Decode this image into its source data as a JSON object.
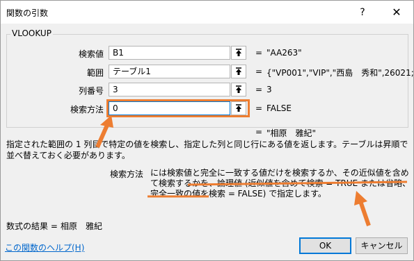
{
  "window": {
    "title": "関数の引数",
    "help_glyph": "?",
    "close_glyph": "✕"
  },
  "function_name": "VLOOKUP",
  "args": [
    {
      "label": "検索値",
      "value": "B1",
      "equals": "=",
      "result": "\"AA263\""
    },
    {
      "label": "範囲",
      "value": "テーブル1",
      "equals": "=",
      "result": "{\"VP001\",\"VIP\",\"西島　秀和\",26021;\""
    },
    {
      "label": "列番号",
      "value": "3",
      "equals": "=",
      "result": "3"
    },
    {
      "label": "検索方法",
      "value": "0",
      "equals": "=",
      "result": "FALSE"
    }
  ],
  "overall_result": {
    "equals": "=",
    "value": "\"相原　雅紀\""
  },
  "description": "指定された範囲の 1 列目で特定の値を検索し、指定した列と同じ行にある値を返します。テーブルは昇順で並べ替えておく必要があります。",
  "arg_help": {
    "name": "検索方法",
    "text": "には検索値と完全に一致する値だけを検索するか、その近似値を含めて検索するかを、論理値 (近似値を含めて検索 = TRUE または省略、完全一致の値を検索 = FALSE) で指定します。"
  },
  "formula_result": {
    "label": "数式の結果 =",
    "value": "相原　雅紀"
  },
  "help_link": "この関数のヘルプ(H)",
  "buttons": {
    "ok": "OK",
    "cancel": "キャンセル"
  },
  "icons": {
    "ref_button": "range-select-icon"
  },
  "colors": {
    "annotation": "#ed7d31",
    "link": "#0066cc",
    "ok_border": "#0078d7"
  }
}
